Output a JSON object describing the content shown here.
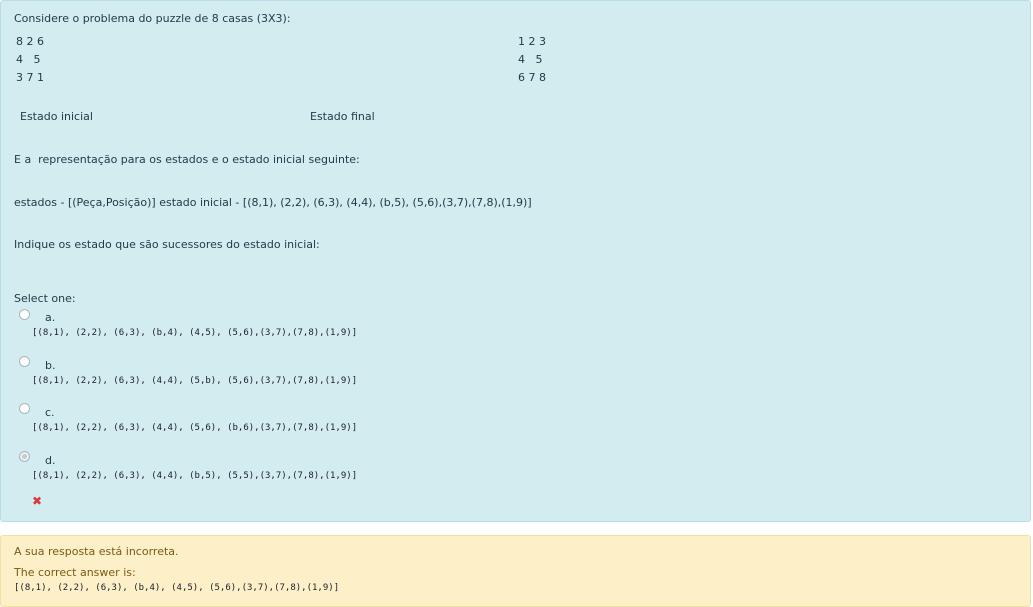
{
  "question": {
    "intro": "Considere o problema do puzzle de 8 casas (3X3):",
    "initial_rows": [
      "8 2 6",
      "4   5",
      "3 7 1"
    ],
    "final_rows": [
      "1 2 3",
      "4   5",
      "6 7 8"
    ],
    "initial_label": "Estado inicial",
    "final_label": "Estado final",
    "repr_text": "E a  representação para os estados e o estado inicial seguinte:",
    "states_text": "estados - [(Peça,Posição)] estado inicial - [(8,1), (2,2), (6,3), (4,4), (b,5), (5,6),(3,7),(7,8),(1,9)]",
    "prompt": "Indique os estado que são sucessores do estado inicial:",
    "select_label": "Select one:",
    "options": [
      {
        "letter": "a.",
        "text": "[(8,1), (2,2), (6,3), (b,4), (4,5), (5,6),(3,7),(7,8),(1,9)]",
        "selected": false
      },
      {
        "letter": "b.",
        "text": "[(8,1), (2,2), (6,3), (4,4), (5,b), (5,6),(3,7),(7,8),(1,9)]",
        "selected": false
      },
      {
        "letter": "c.",
        "text": "[(8,1), (2,2), (6,3), (4,4), (5,6), (b,6),(3,7),(7,8),(1,9)]",
        "selected": false
      },
      {
        "letter": "d.",
        "text": "[(8,1), (2,2), (6,3), (4,4), (b,5), (5,5),(3,7),(7,8),(1,9)]",
        "selected": true
      }
    ],
    "incorrect_mark": "✖"
  },
  "feedback": {
    "incorrect_text": "A sua resposta está incorreta.",
    "correct_label": "The correct answer is:",
    "correct_answer": "[(8,1), (2,2), (6,3), (b,4), (4,5), (5,6),(3,7),(7,8),(1,9)]"
  },
  "colors": {
    "question_bg": "#d3ecf0",
    "feedback_bg": "#fdf0c8",
    "wrong_mark": "#d9393a"
  }
}
